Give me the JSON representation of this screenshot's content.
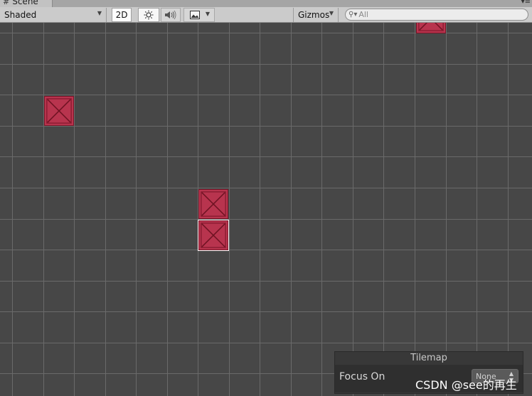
{
  "tab": {
    "title": "Scene",
    "hash_glyph": "#",
    "menu_glyph": "▾≡"
  },
  "toolbar": {
    "draw_mode": "Shaded",
    "mode_2d": "2D",
    "gizmos": "Gizmos",
    "search_placeholder": "All"
  },
  "icons": {
    "lighting": "sun-icon",
    "audio": "speaker-icon",
    "effects": "image-icon",
    "search": "search-icon"
  },
  "colors": {
    "tile_fill": "#b8344e",
    "tile_border": "#7a1427",
    "selection": "#ffffff",
    "scene_bg": "#474747"
  },
  "tilemap_overlay": {
    "title": "Tilemap",
    "focus_label": "Focus On",
    "focus_value": "None"
  },
  "watermark": "CSDN @see的再生"
}
